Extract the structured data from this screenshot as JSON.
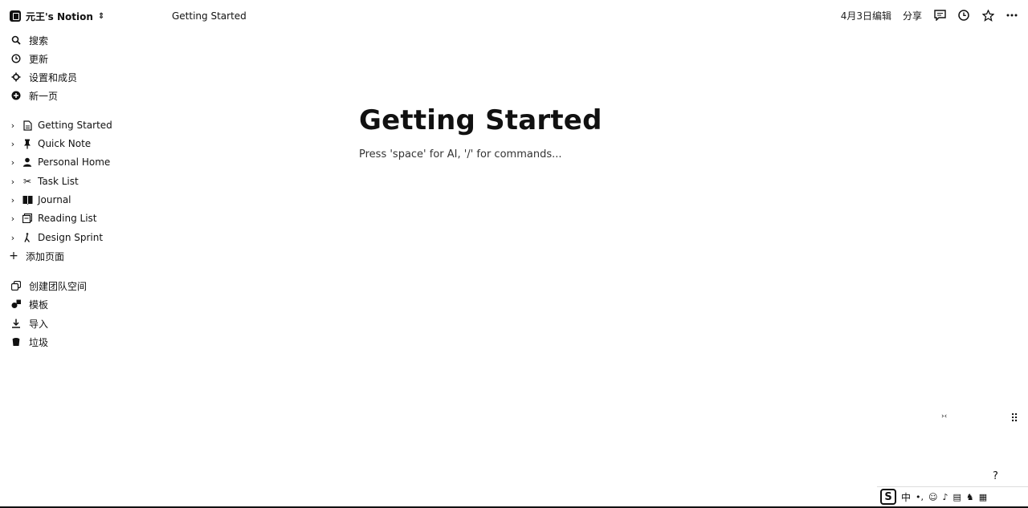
{
  "workspace": {
    "name": "元王's Notion",
    "switch_icon": "chevron-up-down-icon"
  },
  "sidebar": {
    "nav": [
      {
        "label": "搜索",
        "icon": "search-icon"
      },
      {
        "label": "更新",
        "icon": "clock-icon"
      },
      {
        "label": "设置和成员",
        "icon": "gear-icon"
      },
      {
        "label": "新一页",
        "icon": "plus-circle-icon"
      }
    ],
    "pages": [
      {
        "label": "Getting Started",
        "icon": "page-icon"
      },
      {
        "label": "Quick Note",
        "icon": "pin-icon"
      },
      {
        "label": "Personal Home",
        "icon": "person-icon"
      },
      {
        "label": "Task List",
        "icon": "scissors-icon"
      },
      {
        "label": "Journal",
        "icon": "book-icon"
      },
      {
        "label": "Reading List",
        "icon": "books-icon"
      },
      {
        "label": "Design Sprint",
        "icon": "walk-icon"
      }
    ],
    "add_page_label": "添加页面",
    "bottom": [
      {
        "label": "创建团队空间",
        "icon": "team-space-icon"
      },
      {
        "label": "模板",
        "icon": "shapes-icon"
      },
      {
        "label": "导入",
        "icon": "download-icon"
      },
      {
        "label": "垃圾",
        "icon": "trash-icon"
      }
    ]
  },
  "topbar": {
    "breadcrumb": "Getting Started",
    "edited": "4月3日编辑",
    "share_label": "分享",
    "icons": [
      "comment-icon",
      "history-icon",
      "star-icon",
      "more-icon"
    ]
  },
  "page": {
    "title": "Getting Started",
    "placeholder": "Press 'space' for AI, '/' for commands..."
  },
  "misc": {
    "help_label": "?",
    "ime_char": "中"
  }
}
